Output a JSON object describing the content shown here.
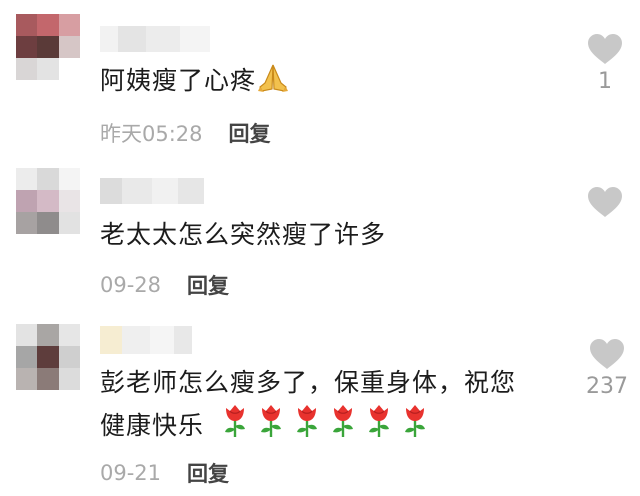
{
  "comments": [
    {
      "text": "阿姨瘦了心疼",
      "emoji": "folded-hands",
      "date": "昨天05:28",
      "reply_label": "回复",
      "like_count": "1"
    },
    {
      "text": "老太太怎么突然瘦了许多",
      "date": "09-28",
      "reply_label": "回复",
      "like_count": ""
    },
    {
      "text_line1": "彭老师怎么瘦多了，保重身体，祝您",
      "text_line2": "健康快乐",
      "emoji": "rose",
      "emoji_count": 6,
      "date": "09-21",
      "reply_label": "回复",
      "like_count": "237"
    }
  ],
  "colors": {
    "like_icon": "#c8c8c8",
    "date_text": "#a9a9a9",
    "reply_text": "#444444",
    "comment_text": "#1c1c1c",
    "rose_red": "#e8322e",
    "rose_green": "#3aa53a"
  }
}
